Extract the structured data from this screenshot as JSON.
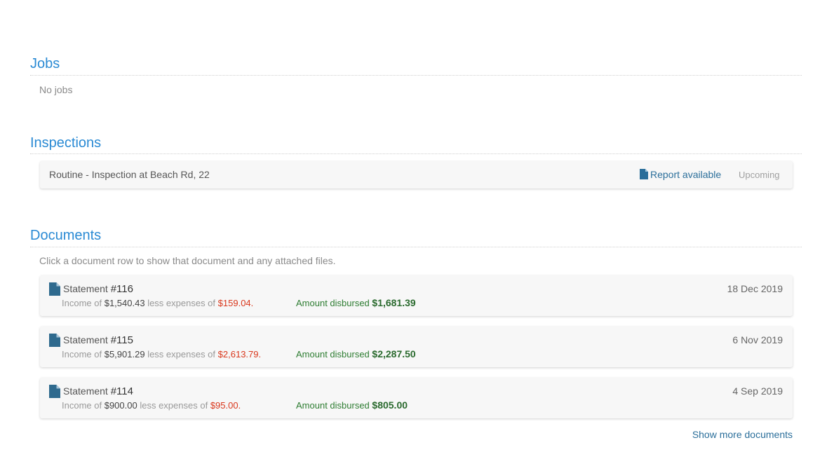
{
  "jobs": {
    "title": "Jobs",
    "empty_text": "No jobs"
  },
  "inspections": {
    "title": "Inspections",
    "items": [
      {
        "title": "Routine - Inspection at Beach Rd, 22",
        "report_label": "Report available",
        "status": "Upcoming"
      }
    ]
  },
  "documents": {
    "title": "Documents",
    "hint": "Click a document row to show that document and any attached files.",
    "items": [
      {
        "label": "Statement",
        "number": "#116",
        "date": "18 Dec 2019",
        "income_prefix": "Income of",
        "income": "$1,540.43",
        "expenses_prefix": "less expenses of",
        "expenses": "$159.04",
        "disbursed_label": "Amount disbursed",
        "disbursed": "$1,681.39"
      },
      {
        "label": "Statement",
        "number": "#115",
        "date": "6 Nov 2019",
        "income_prefix": "Income of",
        "income": "$5,901.29",
        "expenses_prefix": "less expenses of",
        "expenses": "$2,613.79",
        "disbursed_label": "Amount disbursed",
        "disbursed": "$2,287.50"
      },
      {
        "label": "Statement",
        "number": "#114",
        "date": "4 Sep 2019",
        "income_prefix": "Income of",
        "income": "$900.00",
        "expenses_prefix": "less expenses of",
        "expenses": "$95.00",
        "disbursed_label": "Amount disbursed",
        "disbursed": "$805.00"
      }
    ],
    "show_more_label": "Show more documents"
  },
  "colors": {
    "heading": "#2a8ad4",
    "link": "#2a6e9a",
    "expense": "#d9371c",
    "disbursed": "#2e7d32"
  }
}
